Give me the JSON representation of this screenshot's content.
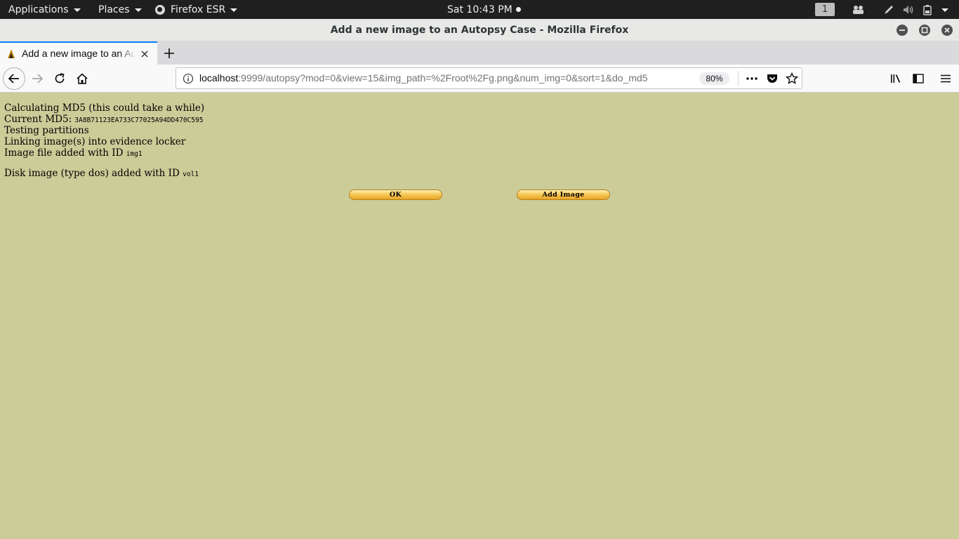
{
  "topbar": {
    "applications": "Applications",
    "places": "Places",
    "firefox": "Firefox ESR",
    "clock": "Sat 10:43 PM",
    "workspace": "1"
  },
  "window": {
    "title": "Add a new image to an Autopsy Case - Mozilla Firefox"
  },
  "tab": {
    "label": "Add a new image to an Autopsy Case"
  },
  "urlbar": {
    "host": "localhost",
    "rest": ":9999/autopsy?mod=0&view=15&img_path=%2Froot%2Fg.png&num_img=0&sort=1&do_md5",
    "zoom": "80%"
  },
  "content": {
    "lines": [
      {
        "text": "Calculating MD5 (this could take a while)",
        "code": ""
      },
      {
        "text": "Current MD5: ",
        "code": "3A8B71123EA733C77025A94DD470C595"
      },
      {
        "text": "Testing partitions",
        "code": ""
      },
      {
        "text": "Linking image(s) into evidence locker",
        "code": ""
      },
      {
        "text": "Image file added with ID ",
        "code": "img1"
      },
      {
        "text": "Disk image (type dos) added with ID ",
        "code": "vol1"
      }
    ],
    "ok_label": "OK",
    "add_image_label": "Add Image"
  }
}
